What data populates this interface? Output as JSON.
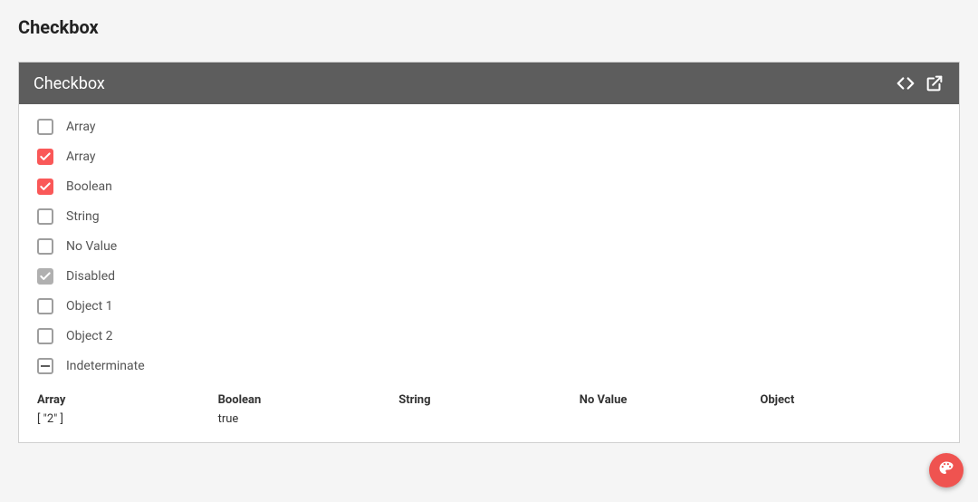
{
  "page": {
    "title": "Checkbox"
  },
  "panel": {
    "title": "Checkbox"
  },
  "checkboxes": [
    {
      "label": "Array",
      "state": "unchecked"
    },
    {
      "label": "Array",
      "state": "checked"
    },
    {
      "label": "Boolean",
      "state": "checked"
    },
    {
      "label": "String",
      "state": "unchecked"
    },
    {
      "label": "No Value",
      "state": "unchecked"
    },
    {
      "label": "Disabled",
      "state": "disabled-checked"
    },
    {
      "label": "Object 1",
      "state": "unchecked"
    },
    {
      "label": "Object 2",
      "state": "unchecked"
    },
    {
      "label": "Indeterminate",
      "state": "indeterminate"
    }
  ],
  "values": [
    {
      "header": "Array",
      "value": "[ \"2\" ]"
    },
    {
      "header": "Boolean",
      "value": "true"
    },
    {
      "header": "String",
      "value": ""
    },
    {
      "header": "No Value",
      "value": ""
    },
    {
      "header": "Object",
      "value": ""
    }
  ],
  "colors": {
    "accent": "#fa5858",
    "header_bg": "#5d5d5d",
    "disabled": "#b0b0b0",
    "fab": "#ef5350"
  }
}
